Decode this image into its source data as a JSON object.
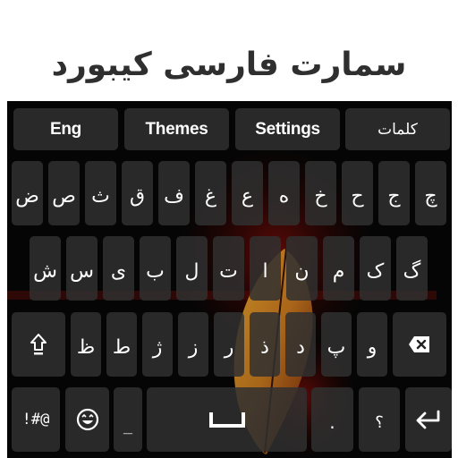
{
  "header": {
    "title": "سمارت فارسی کیبورد"
  },
  "keyboard": {
    "top_row": {
      "eng": "Eng",
      "themes": "Themes",
      "settings": "Settings",
      "words": "کلمات"
    },
    "row1": [
      "ض",
      "ص",
      "ث",
      "ق",
      "ف",
      "غ",
      "ع",
      "ه",
      "خ",
      "ح",
      "ج",
      "چ"
    ],
    "row2": [
      "ش",
      "س",
      "ی",
      "ب",
      "ل",
      "ا",
      "ت",
      "ن",
      "م",
      "ک",
      "گ"
    ],
    "row3": [
      "ظ",
      "ط",
      "ژ",
      "ز",
      "ر",
      "ذ",
      "د",
      "پ",
      "و"
    ],
    "bottom_row": {
      "symbols": "!#@",
      "underscore": "_",
      "period": ".",
      "question": "؟"
    },
    "icons": {
      "shift": "shift-icon",
      "backspace": "backspace-icon",
      "emoji": "emoji-icon",
      "space": "space-icon",
      "enter": "enter-icon"
    },
    "colors": {
      "key_bg": "#303030",
      "keyboard_bg": "#050505",
      "key_text": "#ffffff"
    }
  }
}
